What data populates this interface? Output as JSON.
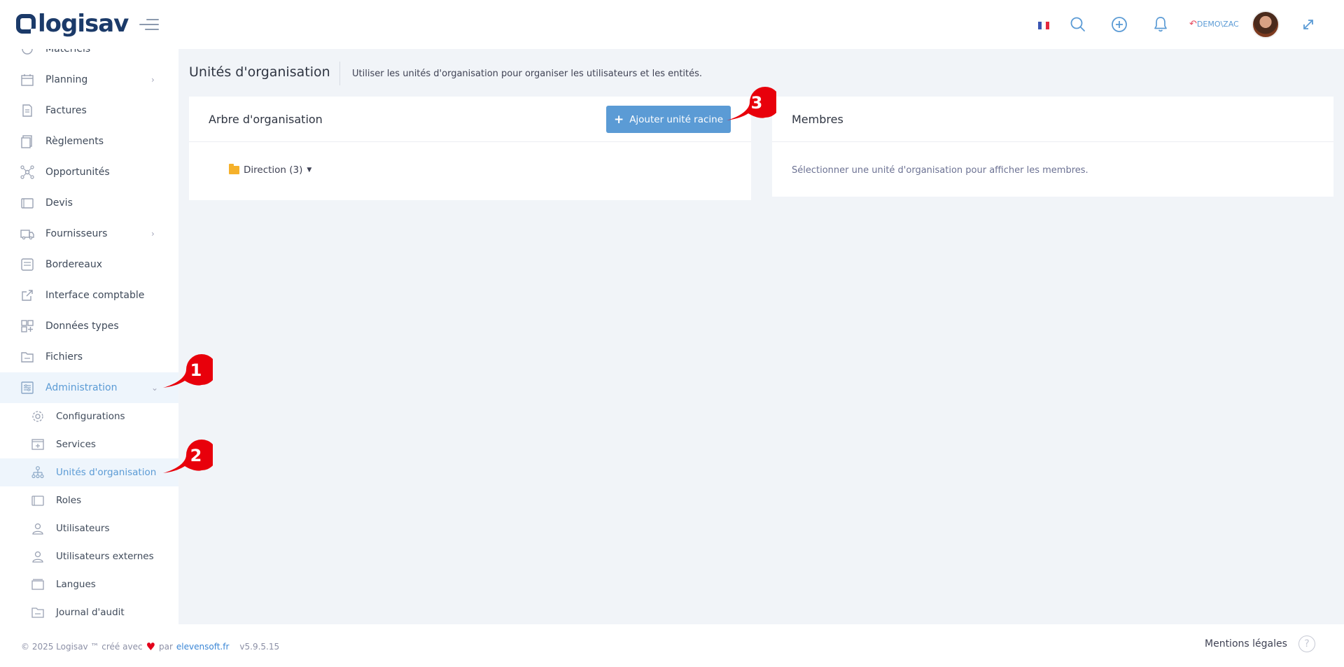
{
  "header": {
    "logo": "logisav",
    "user": "DEMO\\ZAC"
  },
  "sidebar": {
    "items": [
      {
        "label": "Matériels"
      },
      {
        "label": "Planning",
        "chevron": "›"
      },
      {
        "label": "Factures"
      },
      {
        "label": "Règlements"
      },
      {
        "label": "Opportunités"
      },
      {
        "label": "Devis"
      },
      {
        "label": "Fournisseurs",
        "chevron": "›"
      },
      {
        "label": "Bordereaux"
      },
      {
        "label": "Interface comptable"
      },
      {
        "label": "Données types"
      },
      {
        "label": "Fichiers"
      },
      {
        "label": "Administration",
        "chevron": "⌄"
      }
    ],
    "subitems": [
      {
        "label": "Configurations"
      },
      {
        "label": "Services"
      },
      {
        "label": "Unités d'organisation"
      },
      {
        "label": "Roles"
      },
      {
        "label": "Utilisateurs"
      },
      {
        "label": "Utilisateurs externes"
      },
      {
        "label": "Langues"
      },
      {
        "label": "Journal d'audit"
      }
    ]
  },
  "main": {
    "title": "Unités d'organisation",
    "description": "Utiliser les unités d'organisation pour organiser les utilisateurs et les entités.",
    "tree_card": {
      "title": "Arbre d'organisation",
      "add_button": "Ajouter unité racine",
      "node": "Direction (3)"
    },
    "members_card": {
      "title": "Membres",
      "empty": "Sélectionner une unité d'organisation pour afficher les membres."
    }
  },
  "annotations": [
    "1",
    "2",
    "3"
  ],
  "footer": {
    "copyright": "© 2025 Logisav ™ créé avec",
    "by": "par",
    "link": "elevensoft.fr",
    "version": "v5.9.5.15",
    "legal": "Mentions légales",
    "help": "?"
  },
  "colors": {
    "accent": "#5b9bd5",
    "brand": "#1b3a69",
    "annotation": "#e8000b",
    "folder": "#f5b12b"
  }
}
